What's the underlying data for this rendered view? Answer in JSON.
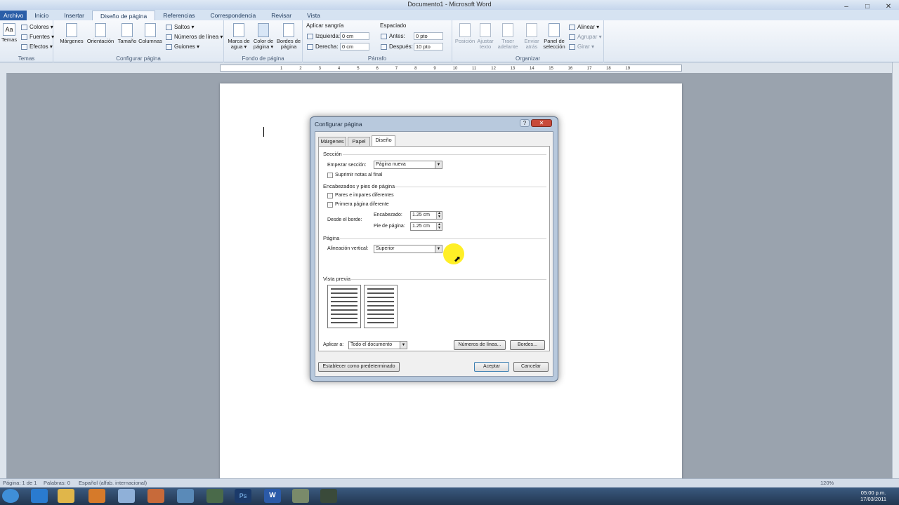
{
  "window": {
    "title": "Documento1 - Microsoft Word"
  },
  "ribbon_tabs": [
    "Archivo",
    "Inicio",
    "Insertar",
    "Diseño de página",
    "Referencias",
    "Correspondencia",
    "Revisar",
    "Vista"
  ],
  "ribbon": {
    "temas": {
      "big_label": "Temas",
      "items": [
        "Colores ▾",
        "Fuentes ▾",
        "Efectos ▾"
      ],
      "group": "Temas"
    },
    "configurar": {
      "margenes": "Márgenes",
      "orientacion": "Orientación",
      "tamano": "Tamaño",
      "columnas": "Columnas",
      "saltos": "Saltos ▾",
      "numeros": "Números de línea ▾",
      "guiones": "Guiones ▾",
      "group": "Configurar página"
    },
    "fondo": {
      "marca": "Marca de agua ▾",
      "color": "Color de página ▾",
      "bordes": "Bordes de página",
      "group": "Fondo de página"
    },
    "parrafo": {
      "sangria": "Aplicar sangría",
      "izquierda": "Izquierda:",
      "izquierda_val": "0 cm",
      "derecha": "Derecha:",
      "derecha_val": "0 cm",
      "espaciado": "Espaciado",
      "antes": "Antes:",
      "antes_val": "0 pto",
      "despues": "Después:",
      "despues_val": "10 pto",
      "group": "Párrafo"
    },
    "organizar": {
      "posicion": "Posición",
      "ajustar": "Ajustar texto",
      "traer": "Traer adelante",
      "enviar": "Enviar atrás",
      "panel": "Panel de selección",
      "alinear": "Alinear ▾",
      "agrupar": "Agrupar ▾",
      "girar": "Girar ▾",
      "group": "Organizar"
    }
  },
  "ruler_ticks": [
    "1",
    "2",
    "3",
    "4",
    "5",
    "6",
    "7",
    "8",
    "9",
    "10",
    "11",
    "12",
    "13",
    "14",
    "15",
    "16",
    "17",
    "18",
    "19"
  ],
  "dialog": {
    "title": "Configurar página",
    "tabs": [
      "Márgenes",
      "Papel",
      "Diseño"
    ],
    "seccion": "Sección",
    "empezar_label": "Empezar sección:",
    "empezar_value": "Página nueva",
    "suprimir": "Suprimir notas al final",
    "encabezados": "Encabezados y pies de página",
    "pares": "Pares e impares diferentes",
    "primera": "Primera página diferente",
    "desde_borde": "Desde el borde:",
    "encabezado_label": "Encabezado:",
    "encabezado_value": "1.25 cm",
    "pie_label": "Pie de página:",
    "pie_value": "1.25 cm",
    "pagina": "Página",
    "alineacion_label": "Alineación vertical:",
    "alineacion_value": "Superior",
    "vista_previa": "Vista previa",
    "aplicar_label": "Aplicar a:",
    "aplicar_value": "Todo el documento",
    "numeros_btn": "Números de línea...",
    "bordes_btn": "Bordes...",
    "predeterminado_btn": "Establecer como predeterminado",
    "aceptar_btn": "Aceptar",
    "cancelar_btn": "Cancelar"
  },
  "status": {
    "pagina": "Página: 1 de 1",
    "palabras": "Palabras: 0",
    "idioma": "Español (alfab. internacional)",
    "zoom": "120%"
  },
  "clock": {
    "time": "05:00 p.m.",
    "date": "17/03/2011"
  },
  "colors": {
    "accent": "#2a5ea8",
    "highlight": "#ffec00"
  }
}
